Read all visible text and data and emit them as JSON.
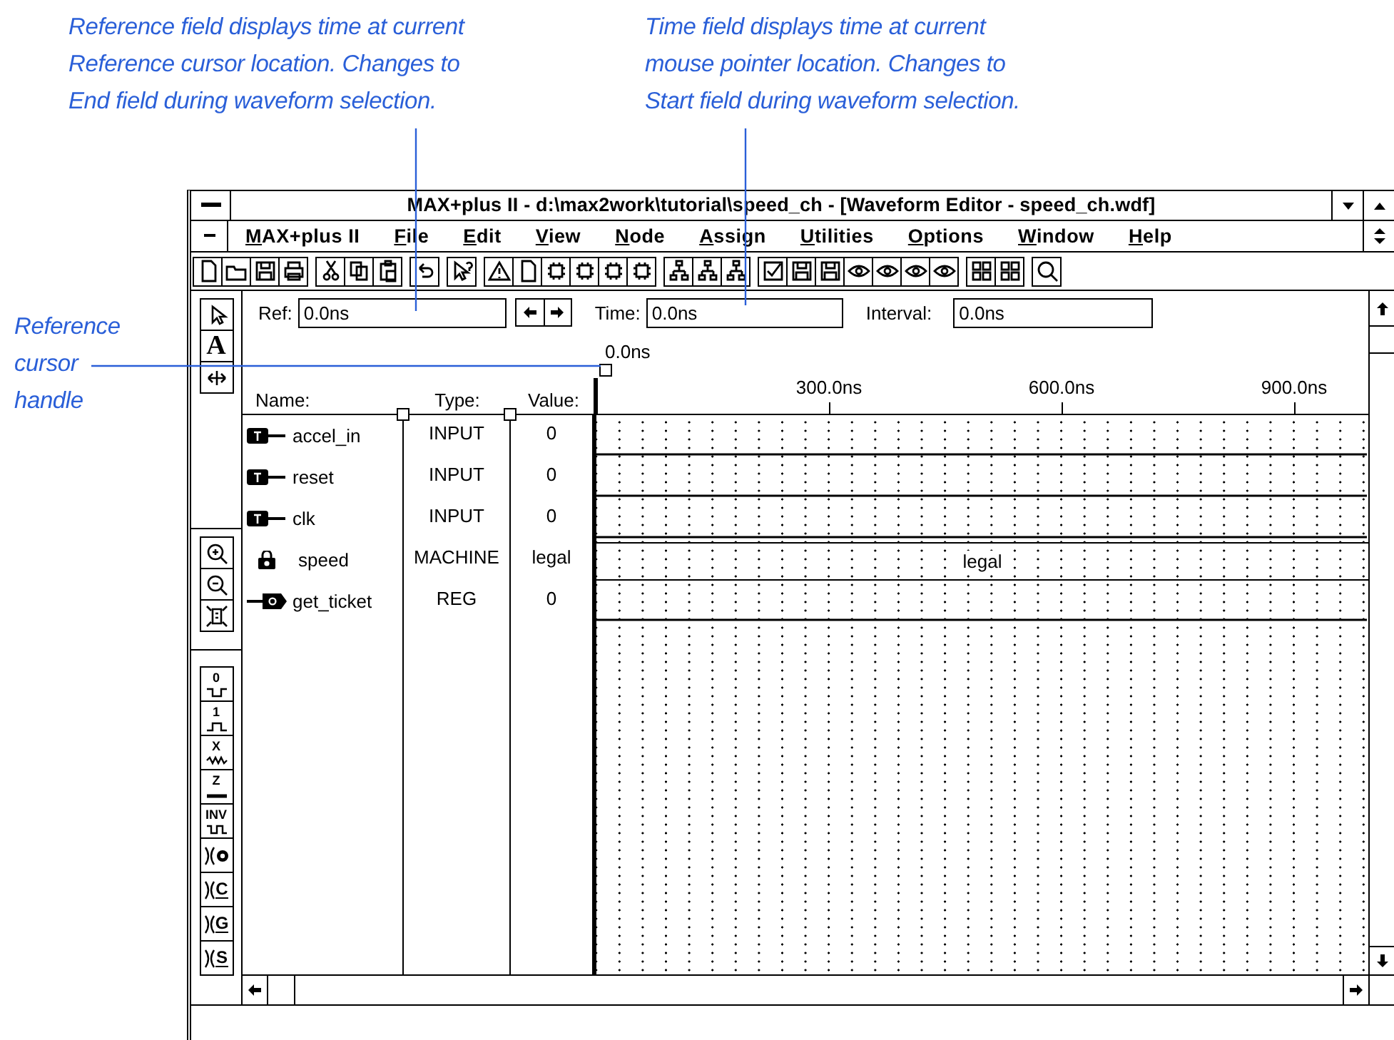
{
  "callouts": [
    {
      "lines": [
        "Reference field displays time at current",
        "Reference cursor location. Changes to",
        "End field during waveform selection."
      ]
    },
    {
      "lines": [
        "Time field displays time at current",
        "mouse pointer location. Changes to",
        "Start field during waveform selection."
      ]
    },
    {
      "lines": [
        "Reference",
        "cursor",
        "handle"
      ]
    }
  ],
  "window": {
    "title": "MAX+plus II - d:\\max2work\\tutorial\\speed_ch - [Waveform Editor - speed_ch.wdf]"
  },
  "menu": [
    "MAX+plus II",
    "File",
    "Edit",
    "View",
    "Node",
    "Assign",
    "Utilities",
    "Options",
    "Window",
    "Help"
  ],
  "palette": {
    "select_tools": [
      {
        "kind": "pointer"
      },
      {
        "kind": "text",
        "label": "A"
      },
      {
        "kind": "stretch"
      }
    ],
    "zoom_tools": [
      {
        "kind": "zoom-in"
      },
      {
        "kind": "zoom-out"
      },
      {
        "kind": "fit"
      }
    ],
    "value_tools": [
      {
        "kind": "level",
        "label": "0"
      },
      {
        "kind": "level",
        "label": "1"
      },
      {
        "kind": "level",
        "label": "X"
      },
      {
        "kind": "level",
        "label": "Z"
      },
      {
        "kind": "level",
        "label": "INV"
      },
      {
        "kind": "overwrite"
      },
      {
        "kind": "overwrite",
        "label": "C"
      },
      {
        "kind": "overwrite",
        "label": "G"
      },
      {
        "kind": "overwrite",
        "label": "S"
      }
    ]
  },
  "fields": {
    "ref": {
      "label": "Ref:",
      "value": "0.0ns"
    },
    "time": {
      "label": "Time:",
      "value": "0.0ns"
    },
    "interval": {
      "label": "Interval:",
      "value": "0.0ns"
    }
  },
  "ruler": {
    "cursor_time": "0.0ns",
    "ticks": [
      "300.0ns",
      "600.0ns",
      "900.0ns"
    ]
  },
  "columns": [
    "Name:",
    "Type:",
    "Value:"
  ],
  "signals": [
    {
      "name": "accel_in",
      "type": "INPUT",
      "value": "0",
      "kind": "input",
      "wave": {
        "kind": "low"
      }
    },
    {
      "name": "reset",
      "type": "INPUT",
      "value": "0",
      "kind": "input",
      "wave": {
        "kind": "low"
      }
    },
    {
      "name": "clk",
      "type": "INPUT",
      "value": "0",
      "kind": "input",
      "wave": {
        "kind": "low"
      }
    },
    {
      "name": "speed",
      "type": "MACHINE",
      "value": "legal",
      "kind": "machine",
      "wave": {
        "kind": "bus",
        "label": "legal"
      }
    },
    {
      "name": "get_ticket",
      "type": "REG",
      "value": "0",
      "kind": "reg",
      "wave": {
        "kind": "low"
      }
    }
  ]
}
